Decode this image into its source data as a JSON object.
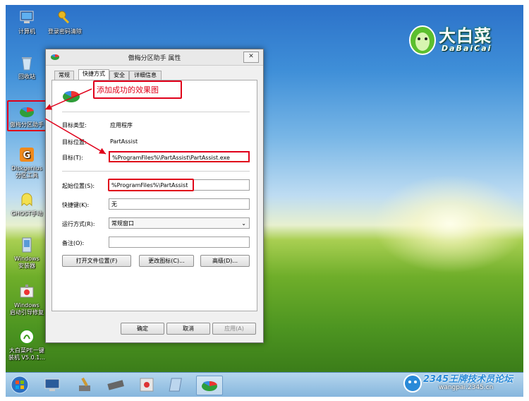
{
  "desktop": {
    "icons": [
      {
        "label": "计算机"
      },
      {
        "label": "登录密码清除"
      },
      {
        "label": "回收站"
      },
      {
        "label": "傲梅分区助手"
      },
      {
        "label": "Diskgenius\n分区工具"
      },
      {
        "label": "GHOST手动"
      },
      {
        "label": "Windows\n安装器"
      },
      {
        "label": "Windows\n启动引导修复"
      },
      {
        "label": "大白菜PE一键\n装机 V5.0.1..."
      }
    ],
    "logo": {
      "cn": "大白菜",
      "en": "DaBaiCai"
    }
  },
  "dialog": {
    "title": "傲梅分区助手 属性",
    "close": "✕",
    "tabs": [
      "常规",
      "快捷方式",
      "安全",
      "详细信息"
    ],
    "annotation": "添加成功的效果图",
    "fields": {
      "target_type_label": "目标类型:",
      "target_type_value": "应用程序",
      "target_location_label": "目标位置:",
      "target_location_value": "PartAssist",
      "target_label": "目标(T):",
      "target_value": "%ProgramFiles%\\PartAssist\\PartAssist.exe",
      "start_in_label": "起始位置(S):",
      "start_in_value": "%ProgramFiles%\\PartAssist",
      "shortcut_key_label": "快捷键(K):",
      "shortcut_key_value": "无",
      "run_label": "运行方式(R):",
      "run_value": "常规窗口",
      "comment_label": "备注(O):",
      "comment_value": ""
    },
    "buttons": {
      "open_location": "打开文件位置(F)",
      "change_icon": "更改图标(C)...",
      "advanced": "高级(D)...",
      "ok": "确定",
      "cancel": "取消",
      "apply": "应用(A)"
    }
  },
  "watermark": {
    "line1": "2345王牌技术员论坛",
    "line2": "wangpai.2345.cn"
  },
  "colors": {
    "annotation_red": "#e0001a",
    "taskbar": "#9cc4e6",
    "accent_green": "#3a9a1a"
  }
}
